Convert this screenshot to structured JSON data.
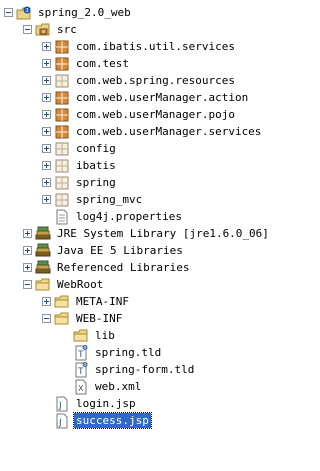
{
  "tree": [
    {
      "label": "spring_2.0_web",
      "depth": 0,
      "toggle": "minus",
      "icon": "java-project-icon"
    },
    {
      "label": "src",
      "depth": 1,
      "toggle": "minus",
      "icon": "source-folder-icon"
    },
    {
      "label": "com.ibatis.util.services",
      "depth": 2,
      "toggle": "plus",
      "icon": "package-icon"
    },
    {
      "label": "com.test",
      "depth": 2,
      "toggle": "plus",
      "icon": "package-icon"
    },
    {
      "label": "com.web.spring.resources",
      "depth": 2,
      "toggle": "plus",
      "icon": "empty-package-icon"
    },
    {
      "label": "com.web.userManager.action",
      "depth": 2,
      "toggle": "plus",
      "icon": "package-icon"
    },
    {
      "label": "com.web.userManager.pojo",
      "depth": 2,
      "toggle": "plus",
      "icon": "package-icon"
    },
    {
      "label": "com.web.userManager.services",
      "depth": 2,
      "toggle": "plus",
      "icon": "package-icon"
    },
    {
      "label": "config",
      "depth": 2,
      "toggle": "plus",
      "icon": "empty-package-icon"
    },
    {
      "label": "ibatis",
      "depth": 2,
      "toggle": "plus",
      "icon": "empty-package-icon"
    },
    {
      "label": "spring",
      "depth": 2,
      "toggle": "plus",
      "icon": "empty-package-icon"
    },
    {
      "label": "spring_mvc",
      "depth": 2,
      "toggle": "plus",
      "icon": "empty-package-icon"
    },
    {
      "label": "log4j.properties",
      "depth": 2,
      "toggle": "none",
      "icon": "properties-file-icon"
    },
    {
      "label": "JRE System Library [jre1.6.0_06]",
      "depth": 1,
      "toggle": "plus",
      "icon": "library-icon"
    },
    {
      "label": "Java EE 5 Libraries",
      "depth": 1,
      "toggle": "plus",
      "icon": "library-icon"
    },
    {
      "label": "Referenced Libraries",
      "depth": 1,
      "toggle": "plus",
      "icon": "library-icon"
    },
    {
      "label": "WebRoot",
      "depth": 1,
      "toggle": "minus",
      "icon": "folder-icon"
    },
    {
      "label": "META-INF",
      "depth": 2,
      "toggle": "plus",
      "icon": "folder-icon"
    },
    {
      "label": "WEB-INF",
      "depth": 2,
      "toggle": "minus",
      "icon": "folder-icon"
    },
    {
      "label": "lib",
      "depth": 3,
      "toggle": "none",
      "icon": "folder-icon"
    },
    {
      "label": "spring.tld",
      "depth": 3,
      "toggle": "none",
      "icon": "tld-file-icon"
    },
    {
      "label": "spring-form.tld",
      "depth": 3,
      "toggle": "none",
      "icon": "tld-file-icon"
    },
    {
      "label": "web.xml",
      "depth": 3,
      "toggle": "none",
      "icon": "xml-file-icon"
    },
    {
      "label": "login.jsp",
      "depth": 2,
      "toggle": "none",
      "icon": "jsp-file-icon"
    },
    {
      "label": "success.jsp",
      "depth": 2,
      "toggle": "none",
      "icon": "jsp-file-icon",
      "selected": true
    }
  ]
}
